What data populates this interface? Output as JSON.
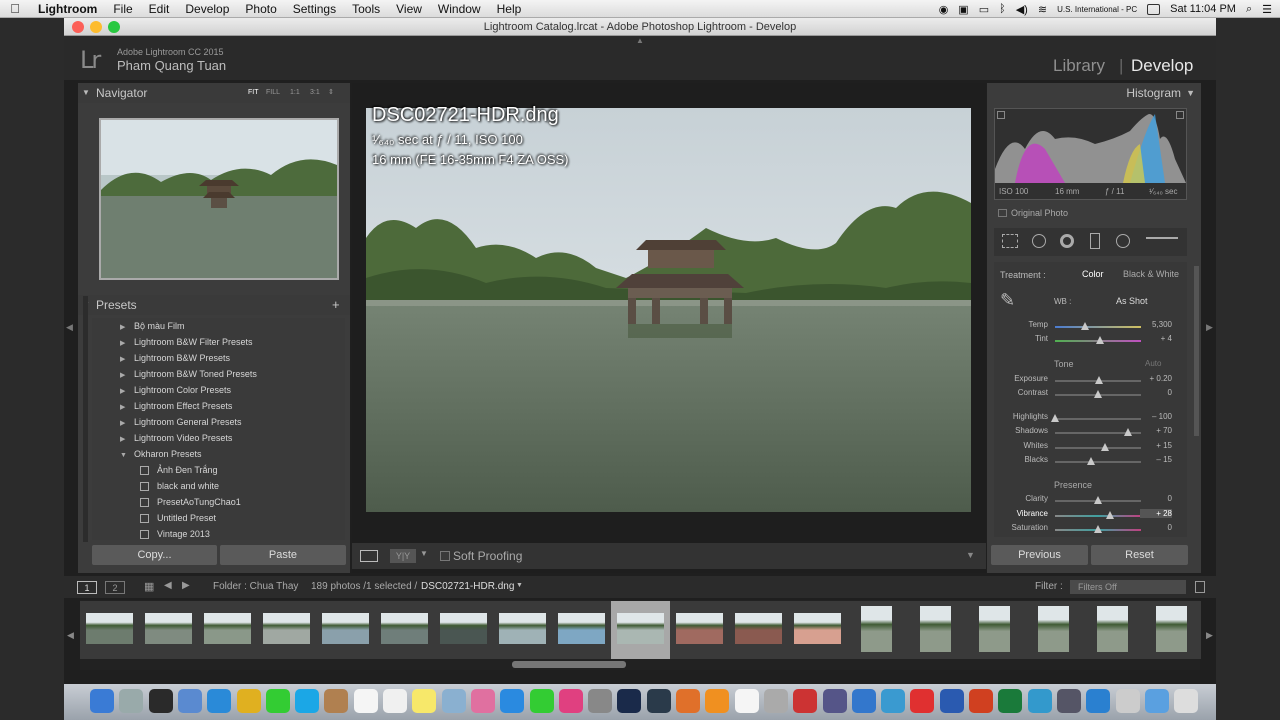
{
  "menubar": {
    "app_name": "Lightroom",
    "items": [
      "File",
      "Edit",
      "Develop",
      "Photo",
      "Settings",
      "Tools",
      "View",
      "Window",
      "Help"
    ],
    "input_source": "U.S. International - PC",
    "clock": "Sat 11:04 PM"
  },
  "window": {
    "title": "Lightroom Catalog.lrcat - Adobe Photoshop Lightroom - Develop"
  },
  "identity": {
    "logo": "Lr",
    "product": "Adobe Lightroom CC 2015",
    "user": "Pham Quang Tuan",
    "module_library": "Library",
    "module_develop": "Develop"
  },
  "navigator": {
    "title": "Navigator",
    "zoom_fit": "FIT",
    "zoom_fill": "FILL",
    "zoom_1_1": "1:1",
    "zoom_3_1": "3:1"
  },
  "presets": {
    "title": "Presets",
    "add": "+",
    "folders": [
      "Bộ màu Film",
      "Lightroom B&W Filter Presets",
      "Lightroom B&W Presets",
      "Lightroom B&W Toned Presets",
      "Lightroom Color Presets",
      "Lightroom Effect Presets",
      "Lightroom General Presets",
      "Lightroom Video Presets",
      "Okharon Presets"
    ],
    "items": [
      "Ảnh Đen Trắng",
      "black and white",
      "PresetAoTungChao1",
      "Untitled Preset",
      "Vintage 2013"
    ]
  },
  "left_buttons": {
    "copy": "Copy...",
    "paste": "Paste"
  },
  "photo_info": {
    "filename": "DSC02721-HDR.dng",
    "exposure": "¹⁄₆₄₀ sec at ƒ / 11, ISO 100",
    "lens": "16 mm (FE 16-35mm F4 ZA OSS)"
  },
  "toolbar": {
    "soft_proofing": "Soft Proofing"
  },
  "histogram": {
    "title": "Histogram",
    "iso": "ISO 100",
    "focal": "16 mm",
    "aperture": "ƒ / 11",
    "shutter": "¹⁄₆₄₀ sec",
    "original_photo": "Original Photo"
  },
  "basic": {
    "treatment_label": "Treatment :",
    "color": "Color",
    "bw": "Black & White",
    "wb_label": "WB :",
    "wb_value": "As Shot",
    "tone_label": "Tone",
    "auto": "Auto",
    "presence_label": "Presence",
    "sliders": [
      {
        "label": "Temp",
        "value": "5,300",
        "pos": 0.35
      },
      {
        "label": "Tint",
        "value": "+ 4",
        "pos": 0.52
      },
      {
        "label": "Exposure",
        "value": "+ 0.20",
        "pos": 0.51
      },
      {
        "label": "Contrast",
        "value": "0",
        "pos": 0.5
      },
      {
        "label": "Highlights",
        "value": "– 100",
        "pos": 0.0
      },
      {
        "label": "Shadows",
        "value": "+ 70",
        "pos": 0.85
      },
      {
        "label": "Whites",
        "value": "+ 15",
        "pos": 0.58
      },
      {
        "label": "Blacks",
        "value": "– 15",
        "pos": 0.42
      },
      {
        "label": "Clarity",
        "value": "0",
        "pos": 0.5
      },
      {
        "label": "Vibrance",
        "value": "+ 28",
        "pos": 0.64
      },
      {
        "label": "Saturation",
        "value": "0",
        "pos": 0.5
      }
    ]
  },
  "right_buttons": {
    "previous": "Previous",
    "reset": "Reset"
  },
  "filmstrip_bar": {
    "view1": "1",
    "view2": "2",
    "folder": "Folder : Chua Thay",
    "count": "189 photos /1 selected /",
    "selected_file": "DSC02721-HDR.dng",
    "filter_label": "Filter :",
    "filter_value": "Filters Off"
  },
  "colors": {
    "panel": "#3c3c3c",
    "background": "#1f1f1f",
    "accent_text": "#e8e8e8"
  }
}
